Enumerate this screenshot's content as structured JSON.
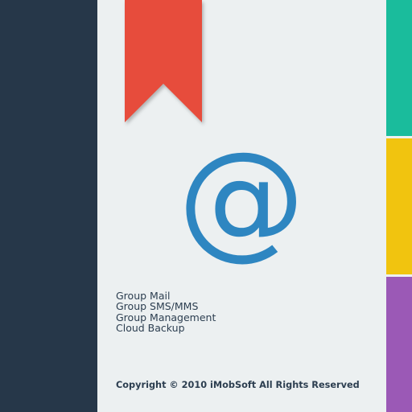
{
  "app_icon": {
    "symbol": "@",
    "features": [
      "Group Mail",
      "Group SMS/MMS",
      "Group Management",
      "Cloud Backup"
    ],
    "copyright": "Copyright © 2010 iMobSoft All Rights Reserved"
  },
  "icons": {
    "bookmark": "bookmark-ribbon-icon",
    "at": "at-sign-icon"
  },
  "colors": {
    "spine": "#263749",
    "page": "#ecf0f1",
    "bookmark": "#e74c3c",
    "at_sign": "#2e86c1",
    "text": "#2c3e50",
    "tab_top": "#1abc9c",
    "tab_middle": "#f1c40f",
    "tab_bottom": "#9b59b6"
  }
}
